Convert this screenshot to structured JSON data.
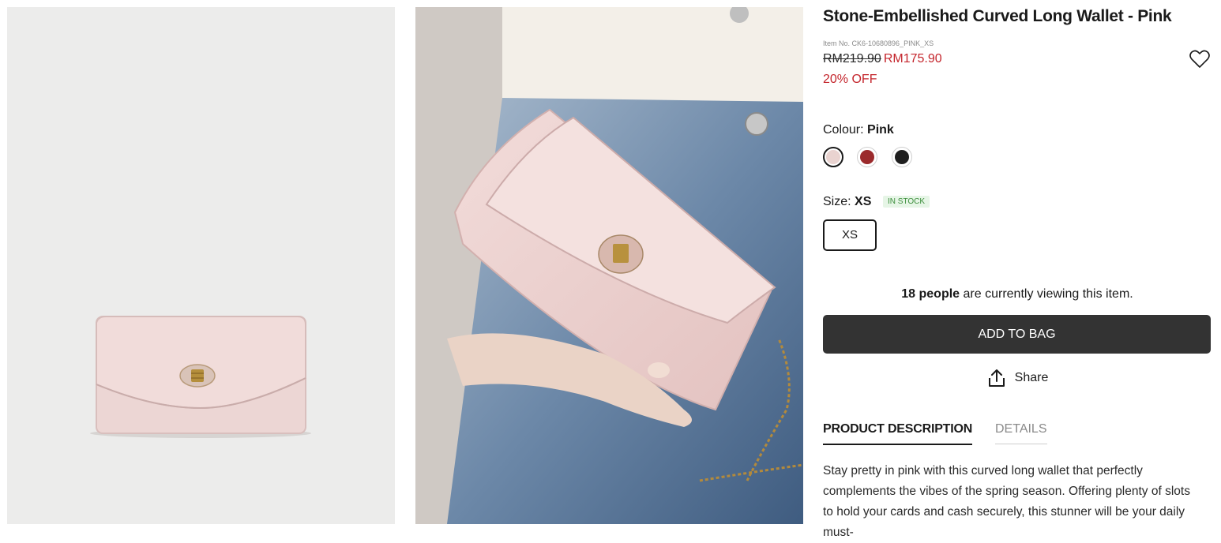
{
  "gallery": {
    "image1_alt": "Stone-Embellished Curved Long Wallet - Pink",
    "image2_alt": "Stone-Embellished Curved Long Wallet - Pink"
  },
  "product": {
    "title": "Stone-Embellished Curved Long Wallet - Pink",
    "item_no": "Item No. CK6-10680896_PINK_XS",
    "original_price": "RM219.90",
    "sale_price": "RM175.90",
    "discount": "20% OFF"
  },
  "colour": {
    "label": "Colour:",
    "selected": "Pink",
    "swatches": [
      {
        "name": "Pink",
        "color": "#e9d3d0",
        "selected": true
      },
      {
        "name": "Red",
        "color": "#9b2a2c",
        "selected": false
      },
      {
        "name": "Black",
        "color": "#1e1e1e",
        "selected": false
      }
    ]
  },
  "size": {
    "label": "Size:",
    "selected": "XS",
    "stock_status": "IN STOCK",
    "options": [
      "XS"
    ]
  },
  "viewers": {
    "count": "18 people",
    "suffix": "are currently viewing this item."
  },
  "actions": {
    "add_to_bag": "ADD TO BAG",
    "share": "Share"
  },
  "tabs": {
    "description": "PRODUCT DESCRIPTION",
    "details": "DETAILS"
  },
  "description": "Stay pretty in pink with this curved long wallet that perfectly complements the vibes of the spring season. Offering plenty of slots to hold your cards and cash securely, this stunner will be your daily must-",
  "icons": {
    "wishlist": "heart-icon",
    "share": "share-icon"
  },
  "colors": {
    "accent_red": "#c4252c",
    "button_dark": "#333333",
    "stock_green": "#3d8f3d"
  }
}
